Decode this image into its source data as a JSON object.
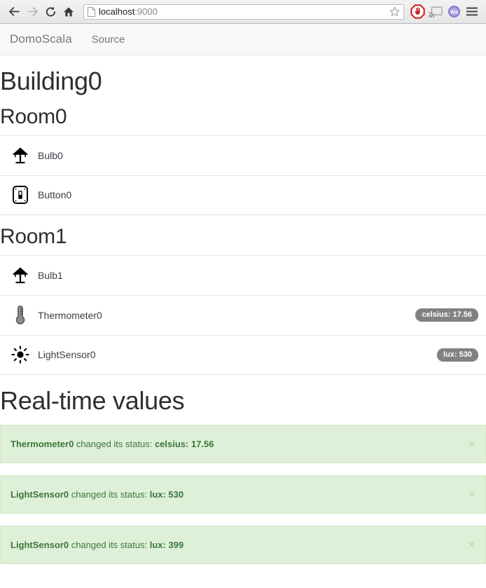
{
  "browser": {
    "back_icon": "back-arrow-icon",
    "forward_icon": "forward-arrow-icon",
    "reload_icon": "reload-icon",
    "home_icon": "home-icon",
    "page_icon": "page-document-icon",
    "url_host": "localhost",
    "url_port": ":9000",
    "url_full": "localhost:9000",
    "star_icon": "bookmark-star-icon",
    "extensions": [
      {
        "name": "adblock-icon",
        "label": "AdBlock"
      },
      {
        "name": "cast-icon",
        "label": "Cast"
      },
      {
        "name": "wolfram-icon",
        "label": "Ws"
      }
    ],
    "menu_icon": "hamburger-menu-icon"
  },
  "navbar": {
    "brand": "DomoScala",
    "links": [
      {
        "label": "Source"
      }
    ]
  },
  "page": {
    "title": "Building0",
    "rooms": [
      {
        "name": "Room0",
        "devices": [
          {
            "icon": "lamp-icon",
            "label": "Bulb0",
            "badge": null
          },
          {
            "icon": "light-switch-icon",
            "label": "Button0",
            "badge": null
          }
        ]
      },
      {
        "name": "Room1",
        "devices": [
          {
            "icon": "lamp-icon",
            "label": "Bulb1",
            "badge": null
          },
          {
            "icon": "thermometer-icon",
            "label": "Thermometer0",
            "badge": "celsius: 17.56"
          },
          {
            "icon": "sun-icon",
            "label": "LightSensor0",
            "badge": "lux: 530"
          }
        ]
      }
    ],
    "realtime_title": "Real-time values",
    "alerts": [
      {
        "device": "Thermometer0",
        "middle": " changed its status: ",
        "value": "celsius: 17.56",
        "close": "×"
      },
      {
        "device": "LightSensor0",
        "middle": " changed its status: ",
        "value": "lux: 530",
        "close": "×"
      },
      {
        "device": "LightSensor0",
        "middle": " changed its status: ",
        "value": "lux: 399",
        "close": "×"
      }
    ]
  },
  "colors": {
    "alert_bg": "#dff0d8",
    "alert_text": "#3c763d",
    "badge_bg": "#818181",
    "navbar_bg": "#f8f8f8",
    "navlink": "#777777"
  }
}
